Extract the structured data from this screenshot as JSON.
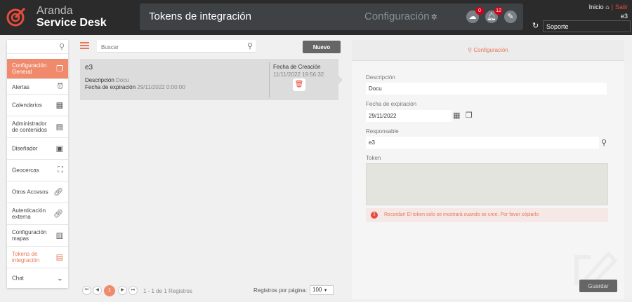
{
  "brand": {
    "line1": "Aranda",
    "line2": "Service Desk"
  },
  "header": {
    "title": "Tokens de integración",
    "section": "Configuración",
    "badges": {
      "cloud": "0",
      "bell": "12"
    }
  },
  "topnav": {
    "inicio": "Inicio",
    "salir": "Salir",
    "user": "e3",
    "support_value": "Soporte"
  },
  "sidebar": {
    "items": [
      {
        "label": "Configuración General"
      },
      {
        "label": "Alertas"
      },
      {
        "label": "Calendarios"
      },
      {
        "label": "Administrador de contenidos"
      },
      {
        "label": "Diseñador"
      },
      {
        "label": "Geocercas"
      },
      {
        "label": "Otros Accesos"
      },
      {
        "label": "Autenticación externa"
      },
      {
        "label": "Configuración mapas"
      },
      {
        "label": "Tokens de integración"
      },
      {
        "label": "Chat"
      }
    ]
  },
  "list": {
    "search_placeholder": "Buscar",
    "new_label": "Nuevo",
    "card": {
      "name": "e3",
      "desc_label": "Descripción",
      "desc_value": "Docu",
      "exp_label": "Fecha de expiración",
      "exp_value": "29/11/2022 0:00:00",
      "created_label": "Fecha de Creación",
      "created_value": "11/11/2022 19:56:32"
    },
    "pager": {
      "current": "1",
      "info": "1 - 1 de 1 Registros",
      "rpp_label": "Registros por página:",
      "rpp_value": "100"
    }
  },
  "form": {
    "header": "Configuración",
    "desc_label": "Descripción",
    "desc_value": "Docu",
    "exp_label": "Fecha de expiración",
    "exp_value": "29/11/2022",
    "resp_label": "Responsable",
    "resp_value": "e3",
    "token_label": "Token",
    "warning": "Recordar! El token solo se mostrará cuando se cree. Por favor cópiarlo",
    "save_label": "Guardar"
  },
  "colors": {
    "accent": "#e8775a",
    "topbar": "#2b2b2b",
    "active": "#f08a6c"
  }
}
